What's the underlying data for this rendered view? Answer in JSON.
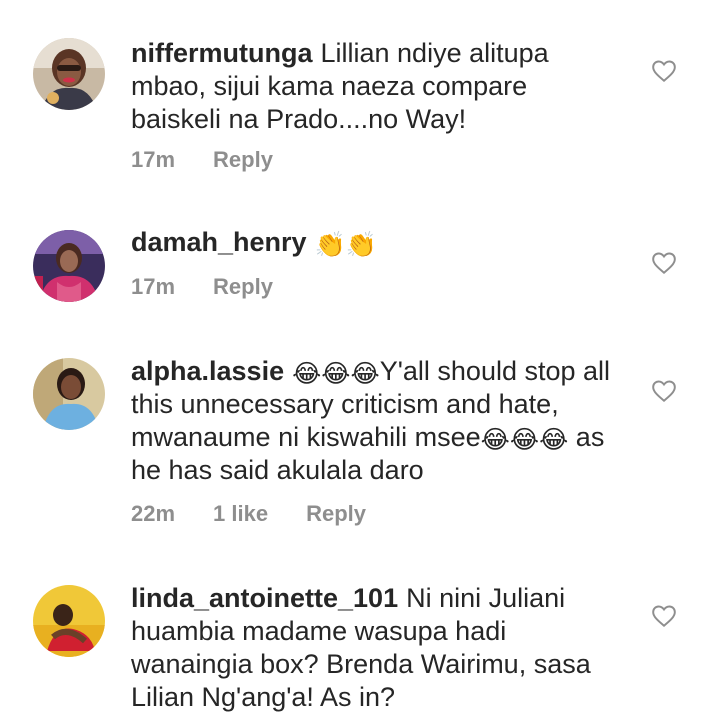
{
  "comments": [
    {
      "username": "niffermutunga",
      "text": "Lillian ndiye alitupa mbao, sijui kama naeza compare baiskeli na Prado....no Way!",
      "time": "17m",
      "likes": "",
      "reply": "Reply"
    },
    {
      "username": "damah_henry",
      "emojis": "👏👏",
      "time": "17m",
      "likes": "",
      "reply": "Reply"
    },
    {
      "username": "alpha.lassie",
      "emojis_a": "😂😂😂",
      "text_a": "Y'all should stop all this unnecessary criticism and hate, mwanaume ni kiswahili msee",
      "emojis_b": "😂😂😂",
      "text_b": "as he has said akulala daro",
      "time": "22m",
      "likes": "1 like",
      "reply": "Reply"
    },
    {
      "username": "linda_antoinette_101",
      "text": "Ni nini Juliani huambia madame wasupa hadi wanaingia box? Brenda Wairimu, sasa Lilian Ng'ang'a! As in?"
    }
  ]
}
